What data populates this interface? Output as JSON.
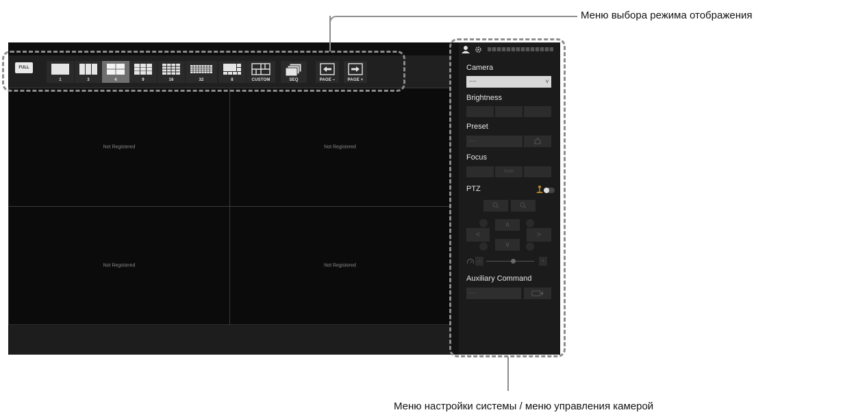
{
  "callouts": {
    "display_mode_menu": "Меню выбора режима отображения",
    "system_camera_menu": "Меню настройки системы / меню управления камерой"
  },
  "toolbar": {
    "full_label": "FULL",
    "layouts": [
      {
        "label": "1"
      },
      {
        "label": "3"
      },
      {
        "label": "4",
        "active": true
      },
      {
        "label": "9"
      },
      {
        "label": "16"
      },
      {
        "label": "32"
      },
      {
        "label": "8"
      },
      {
        "label": "CUSTOM"
      },
      {
        "label": "SEQ"
      },
      {
        "label": "PAGE –"
      },
      {
        "label": "PAGE +"
      }
    ]
  },
  "grid": {
    "cells": [
      {
        "text": "Not Registered"
      },
      {
        "text": "Not Registered"
      },
      {
        "text": "Not Registered"
      },
      {
        "text": "Not Registered"
      }
    ]
  },
  "panel": {
    "camera_label": "Camera",
    "camera_value": "----",
    "camera_chevron": "v",
    "brightness_label": "Brightness",
    "preset_label": "Preset",
    "preset_value": "----",
    "focus_label": "Focus",
    "focus_auto": "Auto",
    "ptz_label": "PTZ",
    "aux_label": "Auxiliary Command",
    "aux_value": "----"
  },
  "colors": {
    "app_bg": "#121212",
    "active_layout": "#6f6f6f",
    "grid_line": "#3a3a3a",
    "callout_dash": "#8c8c8c"
  },
  "icons": [
    "user-icon",
    "gear-icon",
    "arrow-left-icon",
    "arrow-right-icon",
    "home-icon",
    "zoom-in-icon",
    "zoom-out-icon",
    "speed-icon",
    "aux-send-icon",
    "joystick-icon"
  ]
}
